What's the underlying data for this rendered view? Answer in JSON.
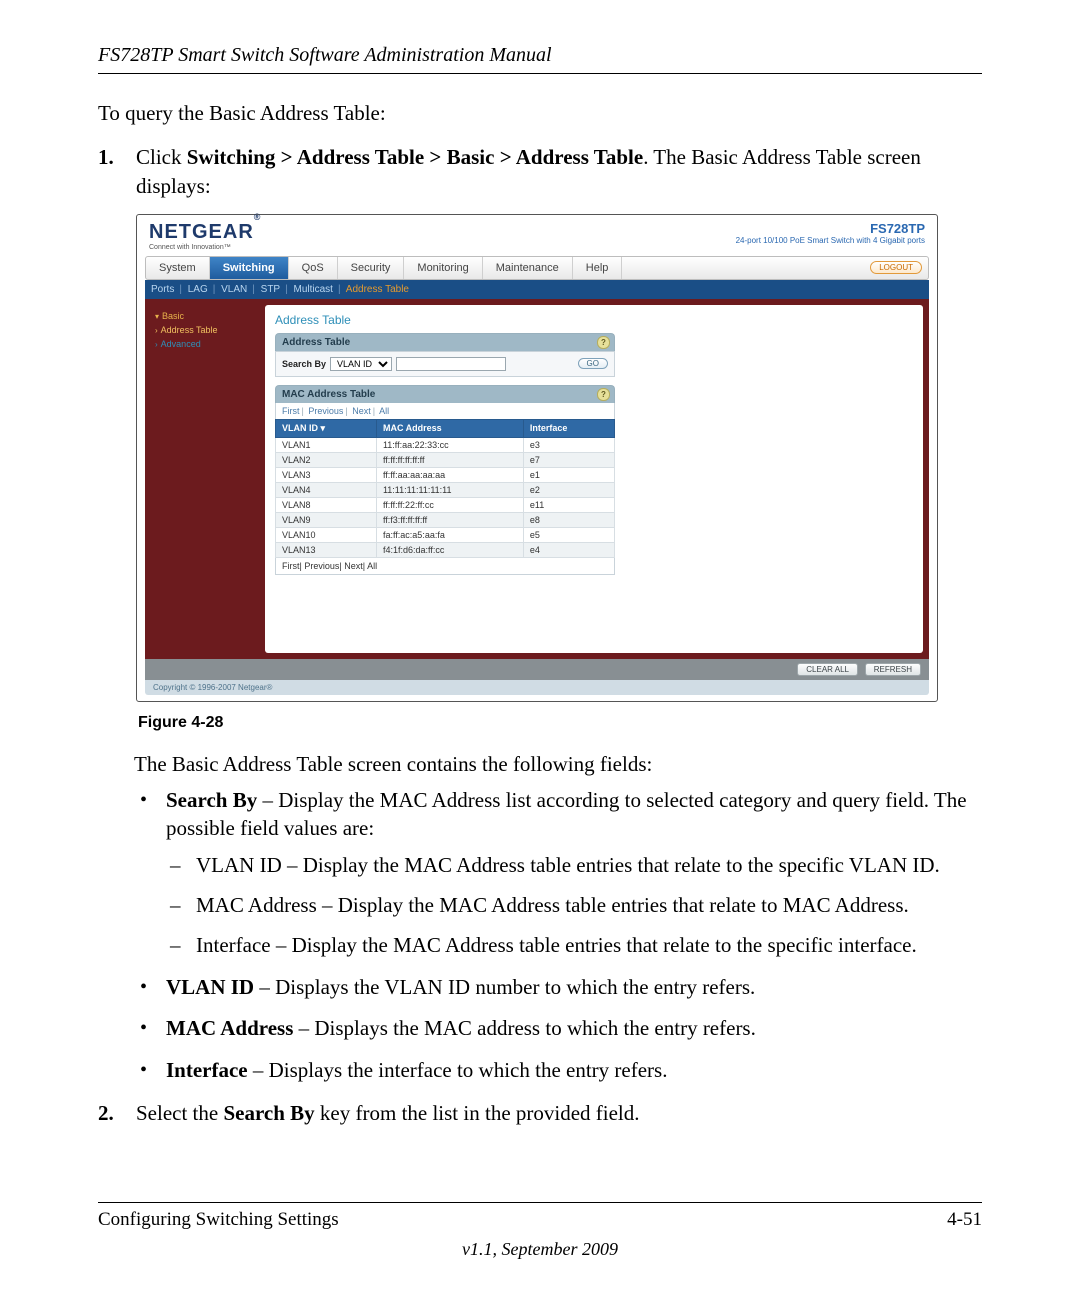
{
  "doc": {
    "running_head": "FS728TP Smart Switch Software Administration Manual",
    "intro": "To query the Basic Address Table:",
    "step1": {
      "num": "1.",
      "pre": "Click ",
      "breadcrumb": "Switching > Address Table > Basic > Address Table",
      "post": ". The Basic Address Table screen displays:"
    },
    "figure_caption": "Figure 4-28",
    "after_figure": "The Basic Address Table screen contains the following fields:",
    "fields": {
      "search_by": {
        "name": "Search By",
        "desc": " – Display the MAC Address list according to selected category and query field. The possible field values are:",
        "opts": {
          "vlan": "VLAN ID – Display the MAC Address table entries that relate to the specific VLAN ID.",
          "mac": "MAC Address – Display the MAC Address table entries that relate to MAC Address.",
          "iface": "Interface – Display the MAC Address table entries that relate to the specific interface."
        }
      },
      "vlan_id": {
        "name": "VLAN ID",
        "desc": " – Displays the VLAN ID number to which the entry refers."
      },
      "mac": {
        "name": "MAC Address",
        "desc": " – Displays the MAC address to which the entry refers."
      },
      "interface": {
        "name": "Interface",
        "desc": " – Displays the interface to which the entry refers."
      }
    },
    "step2": {
      "num": "2.",
      "pre": "Select the ",
      "key": "Search By",
      "post": " key from the list in the provided field."
    },
    "footer_left": "Configuring Switching Settings",
    "footer_right": "4-51",
    "version": "v1.1, September 2009"
  },
  "shot": {
    "logo": "NETGEAR",
    "tagline": "Connect with Innovation™",
    "model": "FS728TP",
    "model_desc": "24-port 10/100 PoE\nSmart Switch with 4 Gigabit ports",
    "logout": "LOGOUT",
    "nav": [
      "System",
      "Switching",
      "QoS",
      "Security",
      "Monitoring",
      "Maintenance",
      "Help"
    ],
    "nav_active_index": 1,
    "subnav": [
      "Ports",
      "LAG",
      "VLAN",
      "STP",
      "Multicast",
      "Address Table"
    ],
    "subnav_active_index": 5,
    "sidebar": {
      "basic": "Basic",
      "address_table": "Address Table",
      "advanced": "Advanced"
    },
    "panel_title": "Address Table",
    "card1": {
      "title": "Address Table",
      "search_label": "Search By",
      "search_options": [
        "VLAN ID"
      ],
      "search_value": "",
      "go": "GO"
    },
    "card2": {
      "title": "MAC Address Table",
      "pager": [
        "First",
        "Previous",
        "Next",
        "All"
      ],
      "columns": [
        "VLAN ID ▾",
        "MAC Address",
        "Interface"
      ],
      "rows": [
        {
          "vlan": "VLAN1",
          "mac": "11:ff:aa:22:33:cc",
          "iface": "e3"
        },
        {
          "vlan": "VLAN2",
          "mac": "ff:ff:ff:ff:ff:ff",
          "iface": "e7"
        },
        {
          "vlan": "VLAN3",
          "mac": "ff:ff:aa:aa:aa:aa",
          "iface": "e1"
        },
        {
          "vlan": "VLAN4",
          "mac": "11:11:11:11:11:11",
          "iface": "e2"
        },
        {
          "vlan": "VLAN8",
          "mac": "ff:ff:ff:22:ff:cc",
          "iface": "e11"
        },
        {
          "vlan": "VLAN9",
          "mac": "ff:f3:ff:ff:ff:ff",
          "iface": "e8"
        },
        {
          "vlan": "VLAN10",
          "mac": "fa:ff:ac:a5:aa:fa",
          "iface": "e5"
        },
        {
          "vlan": "VLAN13",
          "mac": "f4:1f:d6:da:ff:cc",
          "iface": "e4"
        }
      ]
    },
    "buttons": {
      "clear": "CLEAR ALL",
      "refresh": "REFRESH"
    },
    "copyright": "Copyright © 1996-2007 Netgear®"
  }
}
